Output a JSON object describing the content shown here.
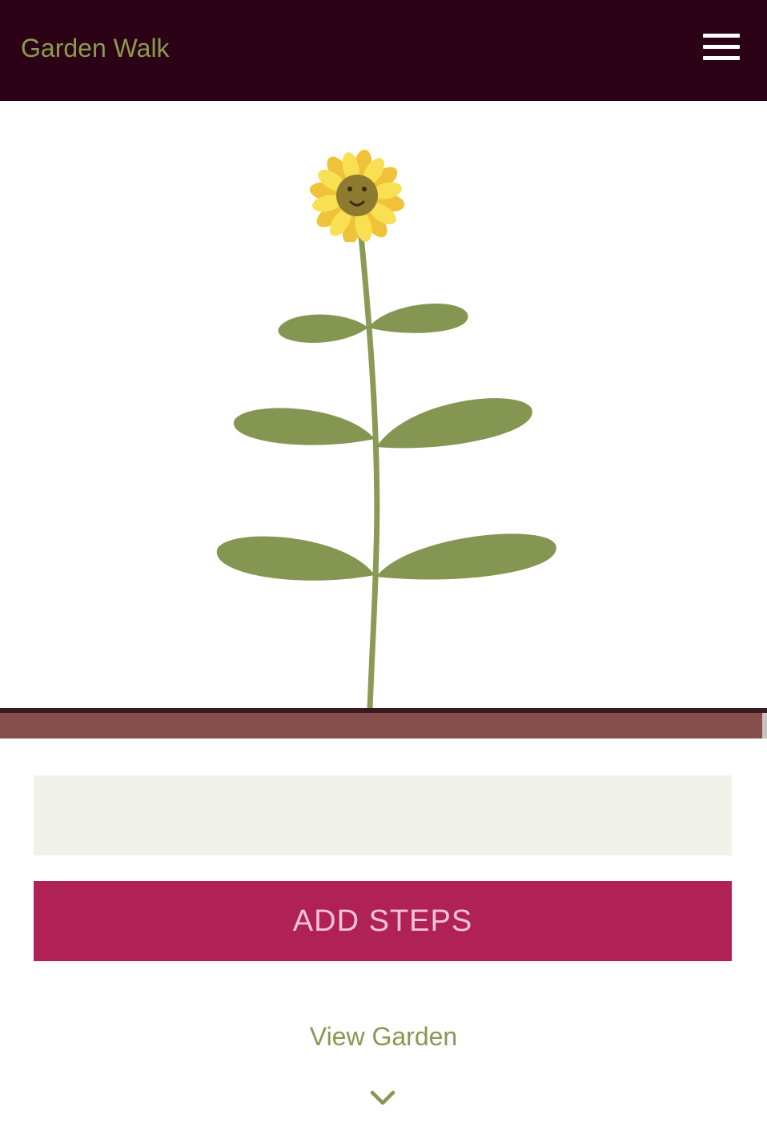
{
  "header": {
    "title": "Garden Walk",
    "menu_icon": "hamburger-menu-icon"
  },
  "plant": {
    "flower_icon": "sunflower-icon",
    "stem_color": "#8b9a55",
    "leaf_color": "#859552",
    "petal_color": "#f6d63f",
    "center_color": "#8f7b2f"
  },
  "steps_input": {
    "value": "",
    "placeholder": ""
  },
  "actions": {
    "add_steps_label": "ADD STEPS",
    "view_garden_label": "View Garden",
    "scroll_icon": "chevron-down-icon"
  },
  "colors": {
    "header_bg": "#2b0216",
    "title_color": "#8b9a4e",
    "button_bg": "#b02254",
    "button_text": "#f7c3d9",
    "input_bg": "#f0f2e9",
    "soil": "#874f4b",
    "link_color": "#879853"
  }
}
